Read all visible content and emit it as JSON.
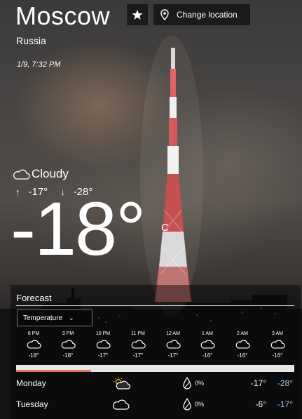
{
  "location": {
    "city": "Moscow",
    "country": "Russia",
    "datetime": "1/9, 7:32 PM"
  },
  "toolbar": {
    "favorite_icon": "star-icon",
    "change_location_label": "Change location",
    "location_icon": "map-pin-icon"
  },
  "current": {
    "condition": "Cloudy",
    "condition_icon": "cloud-icon",
    "high": "-17°",
    "low": "-28°",
    "temperature": "-18°",
    "unit": "C"
  },
  "forecast": {
    "title": "Forecast",
    "dropdown_value": "Temperature",
    "dropdown_icon": "chevron-down-icon",
    "hourly": [
      {
        "time": "8 PM",
        "temp": "-18°",
        "icon": "cloud-icon"
      },
      {
        "time": "9 PM",
        "temp": "-18°",
        "icon": "cloud-icon"
      },
      {
        "time": "10 PM",
        "temp": "-17°",
        "icon": "cloud-icon"
      },
      {
        "time": "11 PM",
        "temp": "-17°",
        "icon": "cloud-icon"
      },
      {
        "time": "12 AM",
        "temp": "-17°",
        "icon": "cloud-icon"
      },
      {
        "time": "1 AM",
        "temp": "-16°",
        "icon": "cloud-icon"
      },
      {
        "time": "2 AM",
        "temp": "-16°",
        "icon": "cloud-icon"
      },
      {
        "time": "3 AM",
        "temp": "-16°",
        "icon": "cloud-icon"
      }
    ],
    "day_progress": 0.27,
    "daily": [
      {
        "day": "Monday",
        "icon": "partly-sunny-icon",
        "precip_icon": "raindrop-icon",
        "precip": "0%",
        "high": "-17°",
        "low": "-28°"
      },
      {
        "day": "Tuesday",
        "icon": "cloud-icon",
        "precip_icon": "raindrop-icon",
        "precip": "0%",
        "high": "-6°",
        "low": "-17°"
      }
    ]
  },
  "colors": {
    "progress": "#e07a5a",
    "low_temp": "#9ec9f0"
  }
}
